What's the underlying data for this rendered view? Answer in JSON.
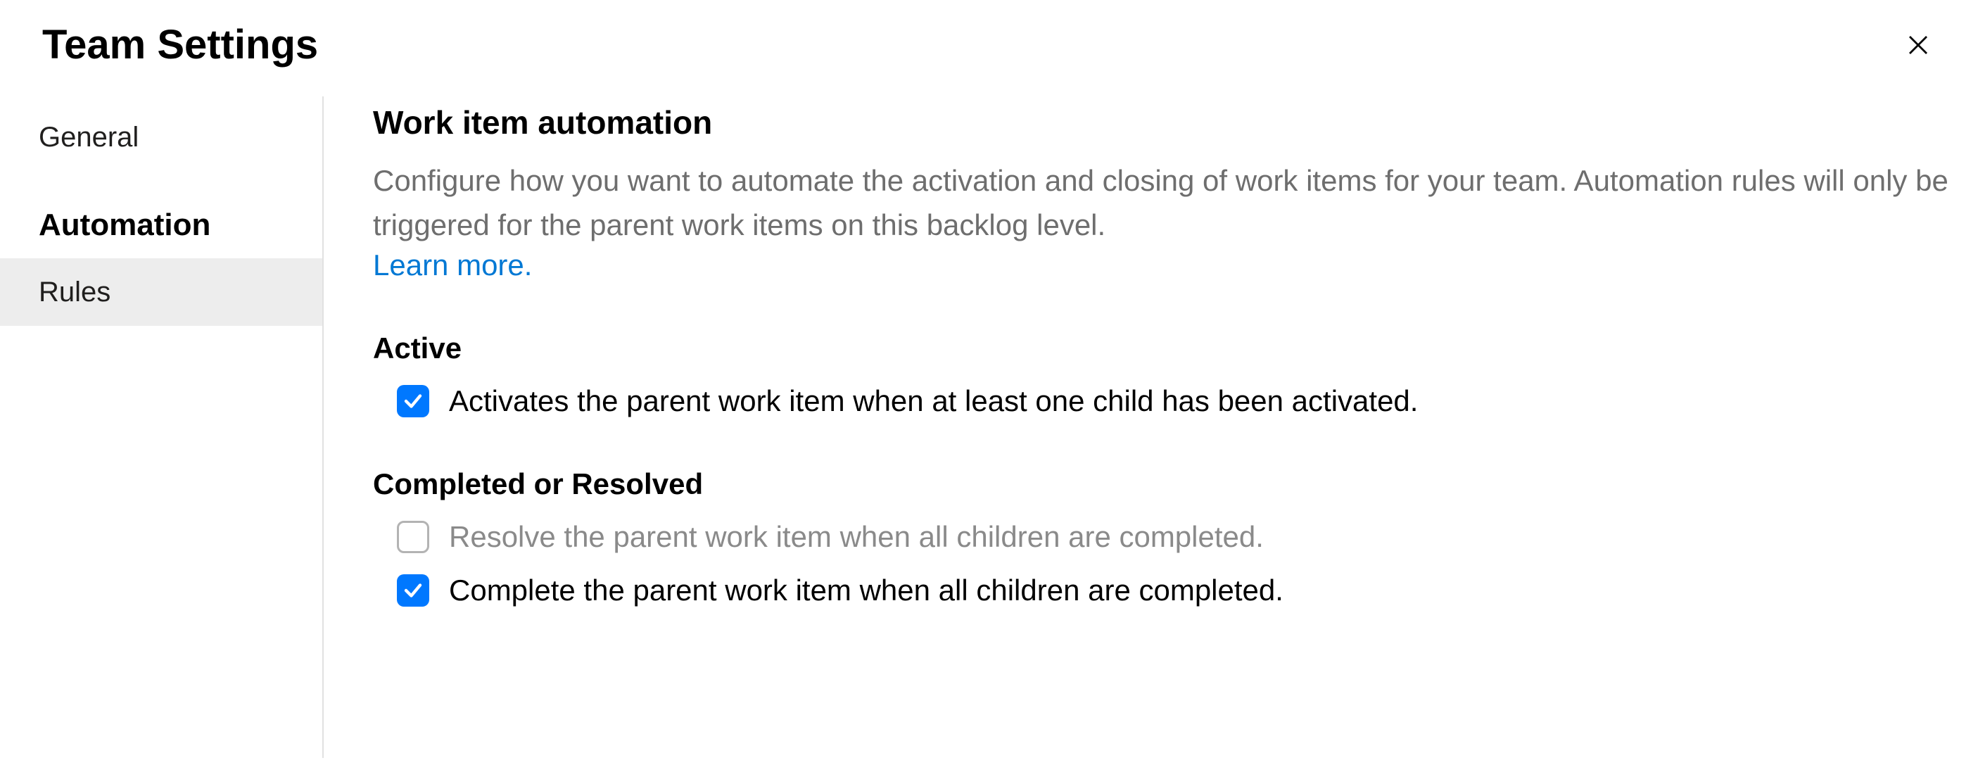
{
  "header": {
    "title": "Team Settings"
  },
  "sidebar": {
    "items": [
      {
        "label": "General",
        "type": "item"
      },
      {
        "label": "Automation",
        "type": "heading"
      },
      {
        "label": "Rules",
        "type": "item",
        "selected": true
      }
    ]
  },
  "content": {
    "title": "Work item automation",
    "description": "Configure how you want to automate the activation and closing of work items for your team. Automation rules will only be triggered for the parent work items on this backlog level.",
    "learn_more": "Learn more.",
    "groups": [
      {
        "title": "Active",
        "rules": [
          {
            "label": "Activates the parent work item when at least one child has been activated.",
            "checked": true,
            "disabled": false
          }
        ]
      },
      {
        "title": "Completed or Resolved",
        "rules": [
          {
            "label": "Resolve the parent work item when all children are completed.",
            "checked": false,
            "disabled": true
          },
          {
            "label": "Complete the parent work item when all children are completed.",
            "checked": true,
            "disabled": false
          }
        ]
      }
    ]
  }
}
